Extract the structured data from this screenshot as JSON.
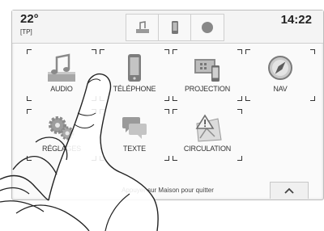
{
  "status": {
    "temperature": "22°",
    "traffic_tag": "[TP]",
    "time": "14:22"
  },
  "quick_access": [
    {
      "icon": "audio-shortcut-icon"
    },
    {
      "icon": "phone-shortcut-icon"
    },
    {
      "icon": "dot-shortcut-icon"
    }
  ],
  "tiles": [
    {
      "label": "AUDIO",
      "icon": "audio-icon"
    },
    {
      "label": "TÉLÉPHONE",
      "icon": "phone-icon"
    },
    {
      "label": "PROJECTION",
      "icon": "projection-icon"
    },
    {
      "label": "NAV",
      "icon": "compass-icon"
    },
    {
      "label": "RÉGLAGES",
      "icon": "settings-gears-icon"
    },
    {
      "label": "TEXTE",
      "icon": "text-message-icon"
    },
    {
      "label": "CIRCULATION",
      "icon": "traffic-warning-icon"
    }
  ],
  "hint": "Appuyer sur Maison pour quitter",
  "colors": {
    "accent": "#000000",
    "panel": "#fafafa",
    "border": "#bdbdbd"
  }
}
